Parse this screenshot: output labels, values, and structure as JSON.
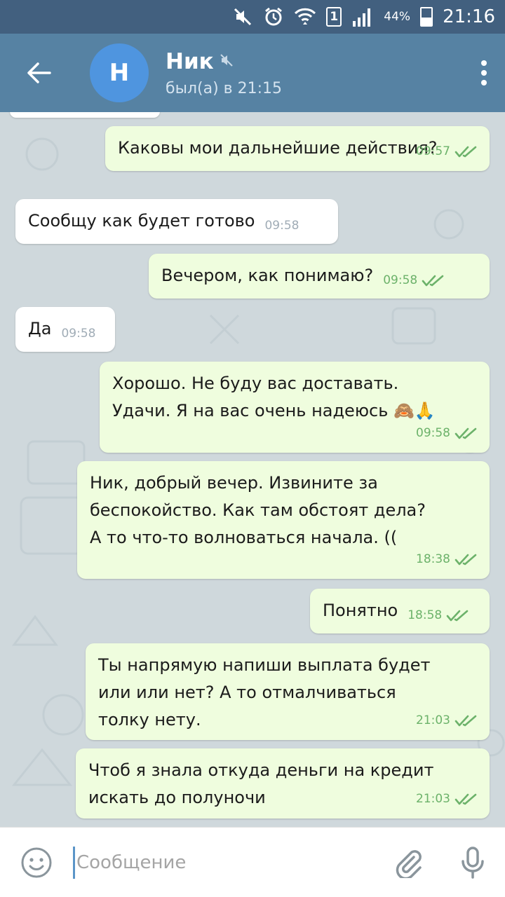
{
  "status_bar": {
    "sim_label": "1",
    "battery_text": "44%",
    "battery_level": 0.44,
    "time": "21:16",
    "icons": [
      "mute-icon",
      "alarm-icon",
      "wifi-icon",
      "sim-icon",
      "signal-icon",
      "battery-icon"
    ]
  },
  "header": {
    "avatar_letter": "Н",
    "name": "Ник",
    "muted": true,
    "last_seen": "был(а) в 21:15",
    "avatar_color": "#4f95df",
    "bar_color": "#5682a3"
  },
  "messages": [
    {
      "dir": "out",
      "text": "Каковы мои дальнейшие действия?",
      "time": "09:57",
      "read": true
    },
    {
      "dir": "in",
      "text": "Сообщу как будет готово",
      "time": "09:58"
    },
    {
      "dir": "out",
      "text": "Вечером, как понимаю?",
      "time": "09:58",
      "read": true
    },
    {
      "dir": "in",
      "text": "Да",
      "time": "09:58"
    },
    {
      "dir": "out",
      "text": "Хорошо. Не буду вас доставать.\nУдачи. Я на вас очень надеюсь 🙈🙏",
      "time": "09:58",
      "read": true
    },
    {
      "dir": "out",
      "text": "Ник, добрый вечер. Извините за\nбеспокойство. Как там обстоят дела?\nА то что-то волноваться начала. ((",
      "time": "18:38",
      "read": true
    },
    {
      "dir": "out",
      "text": "Понятно",
      "time": "18:58",
      "read": true
    },
    {
      "dir": "out",
      "text": "Ты напрямую напиши выплата будет\nили или нет?  А то отмалчиваться\nтолку нету.",
      "time": "21:03",
      "read": true
    },
    {
      "dir": "out",
      "text": "Чтоб я знала откуда деньги на кредит\nискать до полуночи",
      "time": "21:03",
      "read": true
    }
  ],
  "input": {
    "placeholder": "Сообщение",
    "value": ""
  },
  "colors": {
    "outgoing_bubble": "#effdde",
    "incoming_bubble": "#ffffff",
    "read_check": "#6cb26a",
    "chat_background": "#cfd8dc"
  }
}
